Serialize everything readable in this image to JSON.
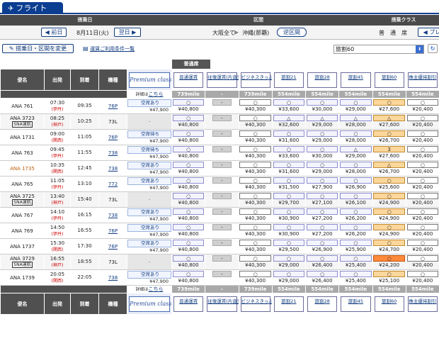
{
  "tab": {
    "title": "フライト",
    "icon": "plane-icon"
  },
  "header": {
    "date": "搭乗日",
    "route": "区間",
    "class": "搭乗クラス"
  },
  "controls": {
    "prev": "◀ 前日",
    "date": "8月11日(火)",
    "next": "翌日 ▶",
    "route_from": "大阪全て",
    "route_to": "沖縄(那覇)",
    "swap": "逆区間",
    "class_label": "普　通　席",
    "class_btn": "◀ プレ"
  },
  "bar2": {
    "change_btn": "搭乗日・区間を変更",
    "conditions_link": "運賃ご利用条件一覧",
    "fare_select": "旅割60"
  },
  "futsu": "普通席",
  "columns": {
    "flight": "便名",
    "dep": "出発",
    "arr": "到着",
    "equip": "機種",
    "premium": "Premium class",
    "details": "詳細は",
    "here": "こちら"
  },
  "fares": [
    {
      "name": "普通運賃",
      "mile": "739mile"
    },
    {
      "name": "往復運賃(片道分)",
      "mile": "-"
    },
    {
      "name": "ビジネスきっぷ(片道分)",
      "mile": "739mile"
    },
    {
      "name": "旅割21",
      "mile": "554mile"
    },
    {
      "name": "旅割28",
      "mile": "554mile"
    },
    {
      "name": "旅割45",
      "mile": "554mile"
    },
    {
      "name": "旅割60",
      "mile": "554mile"
    },
    {
      "name": "株主優待割引",
      "mile": "554mile"
    }
  ],
  "flights": [
    {
      "no": "ANA 761",
      "sna": "",
      "dep": "07:30",
      "dep_ap": "(伊丹)",
      "arr": "09:35",
      "equip": "76P",
      "prem": {
        "status": "空席あり",
        "price": "¥47,900"
      },
      "cells": [
        [
          "○",
          "¥40,800"
        ],
        [
          "-",
          ""
        ],
        [
          "○",
          "¥40,300"
        ],
        [
          "○",
          "¥33,600"
        ],
        [
          "○",
          "¥30,000"
        ],
        [
          "○",
          "¥29,000"
        ],
        [
          "○",
          "¥27,600"
        ],
        [
          "○",
          "¥20,400"
        ]
      ]
    },
    {
      "no": "ANA 3723",
      "sna": "SNA運航",
      "dep": "08:25",
      "dep_ap": "(神戸)",
      "arr": "10:25",
      "equip": "73L",
      "prem": null,
      "cells": [
        [
          "○",
          "¥40,800"
        ],
        [
          "-",
          ""
        ],
        [
          "○",
          "¥40,300"
        ],
        [
          "△",
          "¥32,600"
        ],
        [
          "△",
          "¥29,000"
        ],
        [
          "△",
          "¥28,000"
        ],
        [
          "△",
          "¥27,600"
        ],
        [
          "○",
          "¥20,400"
        ]
      ]
    },
    {
      "no": "ANA 1731",
      "sna": "",
      "dep": "09:00",
      "dep_ap": "(関西)",
      "arr": "11:05",
      "equip": "76P",
      "prem": {
        "status": "空席待ち",
        "price": "¥47,900"
      },
      "cells": [
        [
          "○",
          "¥40,800"
        ],
        [
          "-",
          ""
        ],
        [
          "○",
          "¥40,300"
        ],
        [
          "○",
          "¥31,600"
        ],
        [
          "○",
          "¥29,000"
        ],
        [
          "○",
          "¥28,000"
        ],
        [
          "○",
          "¥26,700"
        ],
        [
          "○",
          "¥20,400"
        ]
      ]
    },
    {
      "no": "ANA 763",
      "sna": "",
      "dep": "09:45",
      "dep_ap": "(伊丹)",
      "arr": "11:55",
      "equip": "738",
      "prem": {
        "status": "空席待ち",
        "price": "¥47,900"
      },
      "cells": [
        [
          "○",
          "¥40,800"
        ],
        [
          "-",
          ""
        ],
        [
          "○",
          "¥40,300"
        ],
        [
          "○",
          "¥33,600"
        ],
        [
          "○",
          "¥30,000"
        ],
        [
          "△",
          "¥29,000"
        ],
        [
          "3",
          "¥27,600"
        ],
        [
          "○",
          "¥20,400"
        ]
      ]
    },
    {
      "no": "ANA 1735",
      "sna": "",
      "dep": "10:35",
      "dep_ap": "(関西)",
      "arr": "12:45",
      "equip": "738",
      "prem": {
        "status": "空席あり",
        "price": "¥47,900"
      },
      "cells": [
        [
          "○",
          "¥40,800"
        ],
        [
          "-",
          ""
        ],
        [
          "○",
          "¥40,300"
        ],
        [
          "○",
          "¥31,600"
        ],
        [
          "○",
          "¥29,000"
        ],
        [
          "○",
          "¥28,000"
        ],
        [
          "△",
          "¥26,700"
        ],
        [
          "○",
          "¥20,400"
        ]
      ]
    },
    {
      "no": "ANA 765",
      "sna": "",
      "dep": "11:05",
      "dep_ap": "(伊丹)",
      "arr": "13:10",
      "equip": "772",
      "prem": {
        "status": "空席あり",
        "price": "¥47,900"
      },
      "cells": [
        [
          "○",
          "¥40,800"
        ],
        [
          "-",
          ""
        ],
        [
          "○",
          "¥40,300"
        ],
        [
          "○",
          "¥31,500"
        ],
        [
          "○",
          "¥27,900"
        ],
        [
          "○",
          "¥26,900"
        ],
        [
          "○",
          "¥25,600"
        ],
        [
          "○",
          "¥20,400"
        ]
      ]
    },
    {
      "no": "ANA 3725",
      "sna": "SNA運航",
      "dep": "13:40",
      "dep_ap": "(神戸)",
      "arr": "15:40",
      "equip": "73L",
      "prem": null,
      "cells": [
        [
          "○",
          "¥40,800"
        ],
        [
          "-",
          ""
        ],
        [
          "○",
          "¥40,300"
        ],
        [
          "○",
          "¥29,700"
        ],
        [
          "○",
          "¥27,100"
        ],
        [
          "○",
          "¥26,100"
        ],
        [
          "○",
          "¥24,900"
        ],
        [
          "○",
          "¥20,400"
        ]
      ]
    },
    {
      "no": "ANA 767",
      "sna": "",
      "dep": "14:10",
      "dep_ap": "(伊丹)",
      "arr": "16:15",
      "equip": "738",
      "prem": {
        "status": "空席あり",
        "price": "¥47,900"
      },
      "cells": [
        [
          "○",
          "¥40,800"
        ],
        [
          "-",
          ""
        ],
        [
          "○",
          "¥40,300"
        ],
        [
          "○",
          "¥30,900"
        ],
        [
          "○",
          "¥27,200"
        ],
        [
          "○",
          "¥26,200"
        ],
        [
          "○",
          "¥24,900"
        ],
        [
          "○",
          "¥20,400"
        ]
      ]
    },
    {
      "no": "ANA 769",
      "sna": "",
      "dep": "14:50",
      "dep_ap": "(伊丹)",
      "arr": "16:55",
      "equip": "76P",
      "prem": {
        "status": "空席あり",
        "price": "¥47,900"
      },
      "cells": [
        [
          "○",
          "¥40,800"
        ],
        [
          "-",
          ""
        ],
        [
          "○",
          "¥40,300"
        ],
        [
          "○",
          "¥30,900"
        ],
        [
          "○",
          "¥27,200"
        ],
        [
          "○",
          "¥26,200"
        ],
        [
          "○",
          "¥24,900"
        ],
        [
          "○",
          "¥20,400"
        ]
      ]
    },
    {
      "no": "ANA 1737",
      "sna": "",
      "dep": "15:30",
      "dep_ap": "(関西)",
      "arr": "17:30",
      "equip": "76P",
      "prem": {
        "status": "空席あり",
        "price": "¥47,900"
      },
      "cells": [
        [
          "○",
          "¥40,800"
        ],
        [
          "-",
          ""
        ],
        [
          "○",
          "¥40,300"
        ],
        [
          "○",
          "¥29,500"
        ],
        [
          "○",
          "¥26,900"
        ],
        [
          "○",
          "¥25,900"
        ],
        [
          "○",
          "¥24,700"
        ],
        [
          "○",
          "¥20,400"
        ]
      ]
    },
    {
      "no": "ANA 3729",
      "sna": "SNA運航",
      "dep": "16:55",
      "dep_ap": "(神戸)",
      "arr": "18:55",
      "equip": "73L",
      "prem": null,
      "cells": [
        [
          "○",
          "¥40,800"
        ],
        [
          "-",
          ""
        ],
        [
          "○",
          "¥40,300"
        ],
        [
          "○",
          "¥29,000"
        ],
        [
          "○",
          "¥26,400"
        ],
        [
          "○",
          "¥25,400"
        ],
        [
          "○",
          "¥24,200"
        ],
        [
          "○",
          "¥20,400"
        ]
      ]
    },
    {
      "no": "ANA 1739",
      "sna": "",
      "dep": "20:05",
      "dep_ap": "(関西)",
      "arr": "22:05",
      "equip": "738",
      "prem": {
        "status": "空席あり",
        "price": "¥47,900"
      },
      "cells": [
        [
          "○",
          "¥40,800"
        ],
        [
          "-",
          ""
        ],
        [
          "○",
          "¥40,300"
        ],
        [
          "○",
          "¥29,000"
        ],
        [
          "○",
          "¥26,400"
        ],
        [
          "○",
          "¥25,400"
        ],
        [
          "○",
          "¥25,100"
        ],
        [
          "○",
          "¥20,400"
        ]
      ]
    }
  ],
  "highlight": {
    "orange_flight": "ANA 1735"
  }
}
